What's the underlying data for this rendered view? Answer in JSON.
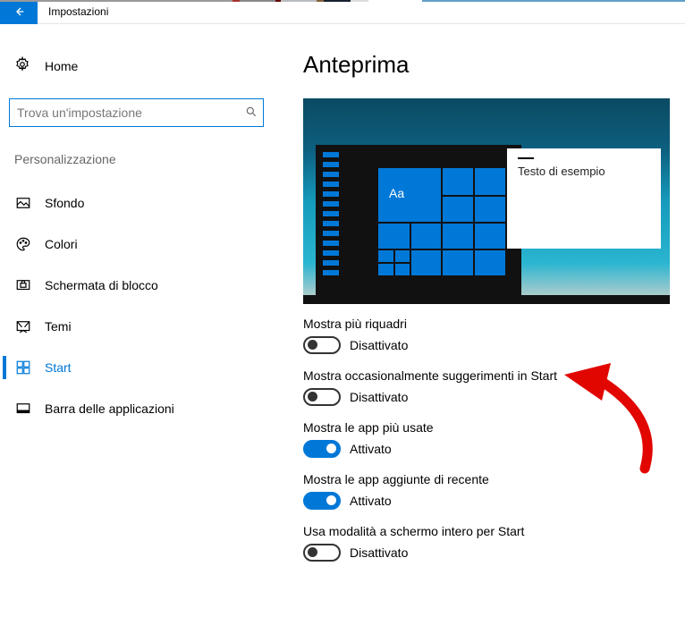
{
  "window": {
    "title": "Impostazioni"
  },
  "sidebar": {
    "home": "Home",
    "search_placeholder": "Trova un'impostazione",
    "section": "Personalizzazione",
    "items": [
      {
        "label": "Sfondo"
      },
      {
        "label": "Colori"
      },
      {
        "label": "Schermata di blocco"
      },
      {
        "label": "Temi"
      },
      {
        "label": "Start",
        "active": true
      },
      {
        "label": "Barra delle applicazioni"
      }
    ]
  },
  "main": {
    "heading": "Anteprima",
    "preview": {
      "tile_label": "Aa",
      "note_text": "Testo di esempio"
    },
    "state_on": "Attivato",
    "state_off": "Disattivato",
    "settings": [
      {
        "label": "Mostra più riquadri",
        "on": false
      },
      {
        "label": "Mostra occasionalmente suggerimenti in Start",
        "on": false
      },
      {
        "label": "Mostra le app più usate",
        "on": true
      },
      {
        "label": "Mostra le app aggiunte di recente",
        "on": true
      },
      {
        "label": "Usa modalità a schermo intero per Start",
        "on": false
      }
    ]
  }
}
